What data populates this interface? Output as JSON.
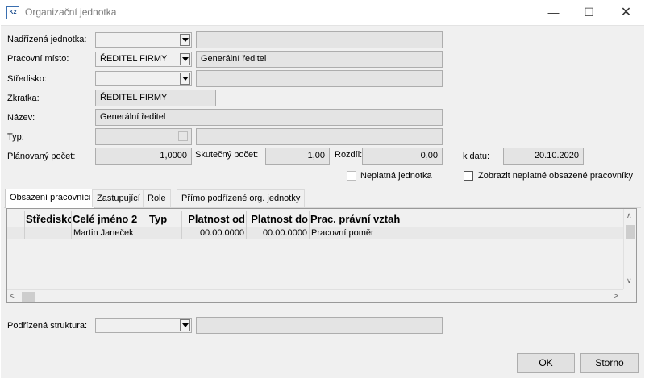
{
  "window": {
    "title": "Organizační jednotka",
    "app_icon": "K2"
  },
  "form": {
    "nadrizena_label": "Nadřízená jednotka:",
    "nadrizena_value": "",
    "nadrizena_name": "",
    "pracovni_label": "Pracovní místo:",
    "pracovni_value": "ŘEDITEL FIRMY",
    "pracovni_name": "Generální ředitel",
    "stredisko_label": "Středisko:",
    "stredisko_value": "",
    "stredisko_name": "",
    "zkratka_label": "Zkratka:",
    "zkratka_value": "ŘEDITEL FIRMY",
    "nazev_label": "Název:",
    "nazev_value": "Generální ředitel",
    "typ_label": "Typ:",
    "typ_name": "",
    "planovany_label": "Plánovaný počet:",
    "planovany_value": "1,0000",
    "skutecny_label": "Skutečný počet:",
    "skutecny_value": "1,00",
    "rozdil_label": "Rozdíl:",
    "rozdil_value": "0,00",
    "kdatu_label": "k datu:",
    "kdatu_value": "20.10.2020",
    "neplatna_label": "Neplatná jednotka",
    "zobrazit_label": "Zobrazit neplatné obsazené pracovníky"
  },
  "tabs": [
    {
      "label": "Obsazení pracovníci"
    },
    {
      "label": "Zastupující"
    },
    {
      "label": "Role"
    },
    {
      "label": "Přímo podřízené org. jednotky"
    }
  ],
  "grid": {
    "columns": [
      "Středisko",
      "Celé jméno 2",
      "Typ",
      "Platnost od",
      "Platnost do",
      "Prac. právní vztah"
    ],
    "rows": [
      [
        "",
        "Martin Janeček",
        "",
        "00.00.0000",
        "00.00.0000",
        "Pracovní poměr"
      ]
    ]
  },
  "bottom": {
    "struktura_label": "Podřízená struktura:",
    "struktura_value": ""
  },
  "buttons": {
    "ok": "OK",
    "storno": "Storno"
  },
  "colors": {
    "panel": "#f0f0f0",
    "field_border": "#adadad",
    "grid_selected": "#e8e8e8"
  }
}
